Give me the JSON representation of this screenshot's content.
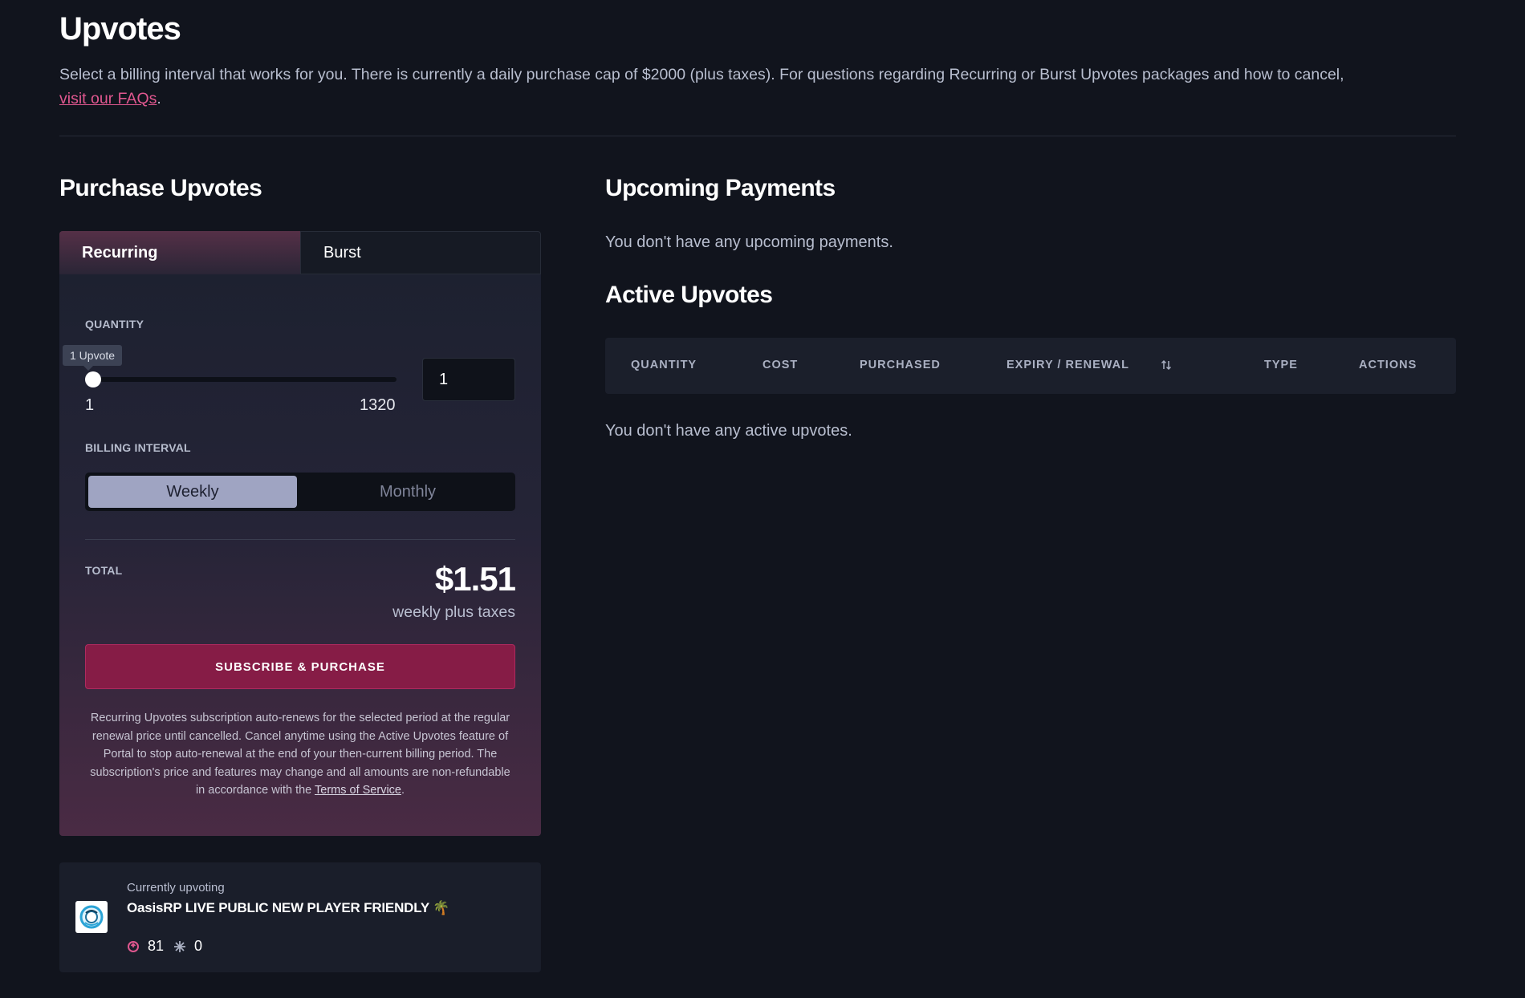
{
  "header": {
    "title": "Upvotes",
    "intro_text": "Select a billing interval that works for you. There is currently a daily purchase cap of $2000 (plus taxes). For questions regarding Recurring or Burst Upvotes packages and how to cancel,",
    "intro_link": "visit our FAQs",
    "intro_end": "."
  },
  "purchase": {
    "title": "Purchase Upvotes",
    "tabs": [
      {
        "label": "Recurring",
        "active": true
      },
      {
        "label": "Burst",
        "active": false
      }
    ],
    "quantity_label": "QUANTITY",
    "slider_tooltip": "1 Upvote",
    "slider_min": "1",
    "slider_max": "1320",
    "slider_value_fraction": 0.0,
    "quantity_value": "1",
    "billing_label": "BILLING INTERVAL",
    "billing_options": [
      "Weekly",
      "Monthly"
    ],
    "billing_selected": "Weekly",
    "total_label": "TOTAL",
    "total_amount": "$1.51",
    "total_sub": "weekly plus taxes",
    "subscribe_label": "SUBSCRIBE & PURCHASE",
    "disclaimer": "Recurring Upvotes subscription auto-renews for the selected period at the regular renewal price until cancelled. Cancel anytime using the Active Upvotes feature of Portal to stop auto-renewal at the end of your then-current billing period. The subscription's price and features may change and all amounts are non-refundable in accordance with the",
    "disclaimer_link": "Terms of Service",
    "disclaimer_end": "."
  },
  "current": {
    "eyebrow": "Currently upvoting",
    "server_name": "OasisRP LIVE PUBLIC NEW PLAYER FRIENDLY 🌴",
    "upvotes": "81",
    "burst": "0"
  },
  "upcoming": {
    "title": "Upcoming Payments",
    "empty": "You don't have any upcoming payments."
  },
  "active": {
    "title": "Active Upvotes",
    "columns": [
      "QUANTITY",
      "COST",
      "PURCHASED",
      "EXPIRY / RENEWAL",
      "TYPE",
      "ACTIONS"
    ],
    "sort_icon": "sort-arrows-icon",
    "empty": "You don't have any active upvotes."
  },
  "colors": {
    "background": "#11141d",
    "accent_pink": "#e0578f",
    "button": "#861c46"
  }
}
